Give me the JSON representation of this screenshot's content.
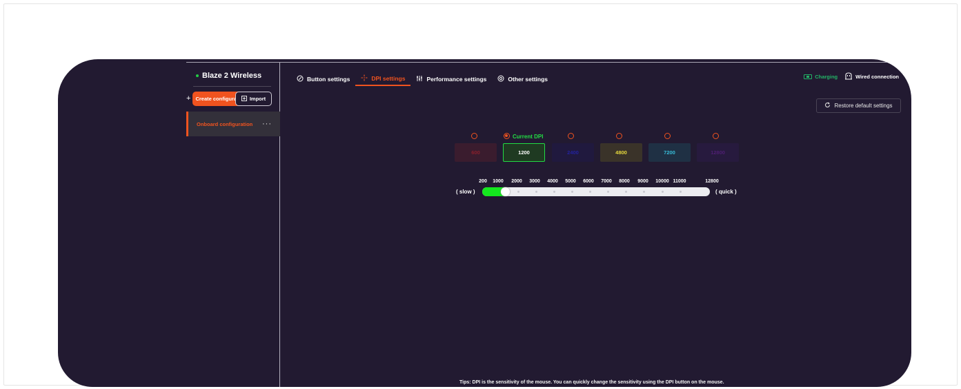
{
  "device": {
    "name": "Blaze 2 Wireless",
    "status_color": "#22cc44"
  },
  "sidebar": {
    "create_label": "Create configuration",
    "import_label": "Import",
    "onboard_label": "Onboard configuration",
    "more_label": "···"
  },
  "tabs": [
    {
      "label": "Button settings",
      "icon": "mouse-icon",
      "active": false
    },
    {
      "label": "DPI settings",
      "icon": "crosshair-icon",
      "active": true
    },
    {
      "label": "Performance settings",
      "icon": "sliders-icon",
      "active": false
    },
    {
      "label": "Other settings",
      "icon": "gear-icon",
      "active": false
    }
  ],
  "status": {
    "charging_label": "Charging",
    "wired_label": "Wired connection"
  },
  "restore_label": "Restore default settings",
  "dpi": {
    "current_label": "Current DPI",
    "selected_index": 1,
    "levels": [
      {
        "value": "600",
        "bg": "#3a1c2e",
        "fg": "#8a1f2c",
        "border": "none"
      },
      {
        "value": "1200",
        "bg": "#1f3a22",
        "fg": "#ffffff",
        "border": "#22dd44"
      },
      {
        "value": "2400",
        "bg": "#20193e",
        "fg": "#23229e",
        "border": "none"
      },
      {
        "value": "4800",
        "bg": "#3a3329",
        "fg": "#e6d93d",
        "border": "none"
      },
      {
        "value": "7200",
        "bg": "#1f3044",
        "fg": "#37bcd8",
        "border": "none"
      },
      {
        "value": "12800",
        "bg": "#271a3e",
        "fg": "#4f1e73",
        "border": "none"
      }
    ]
  },
  "slider": {
    "slow_label": "( slow )",
    "quick_label": "( quick )",
    "ticks": [
      "200",
      "1000",
      "2000",
      "3000",
      "4000",
      "5000",
      "6000",
      "7000",
      "8000",
      "9000",
      "10000",
      "11000",
      "12800"
    ],
    "min": 200,
    "max": 12800,
    "value": 1200
  },
  "tips": "Tips: DPI is the sensitivity of the mouse. You can quickly change the sensitivity using the DPI button on the mouse."
}
